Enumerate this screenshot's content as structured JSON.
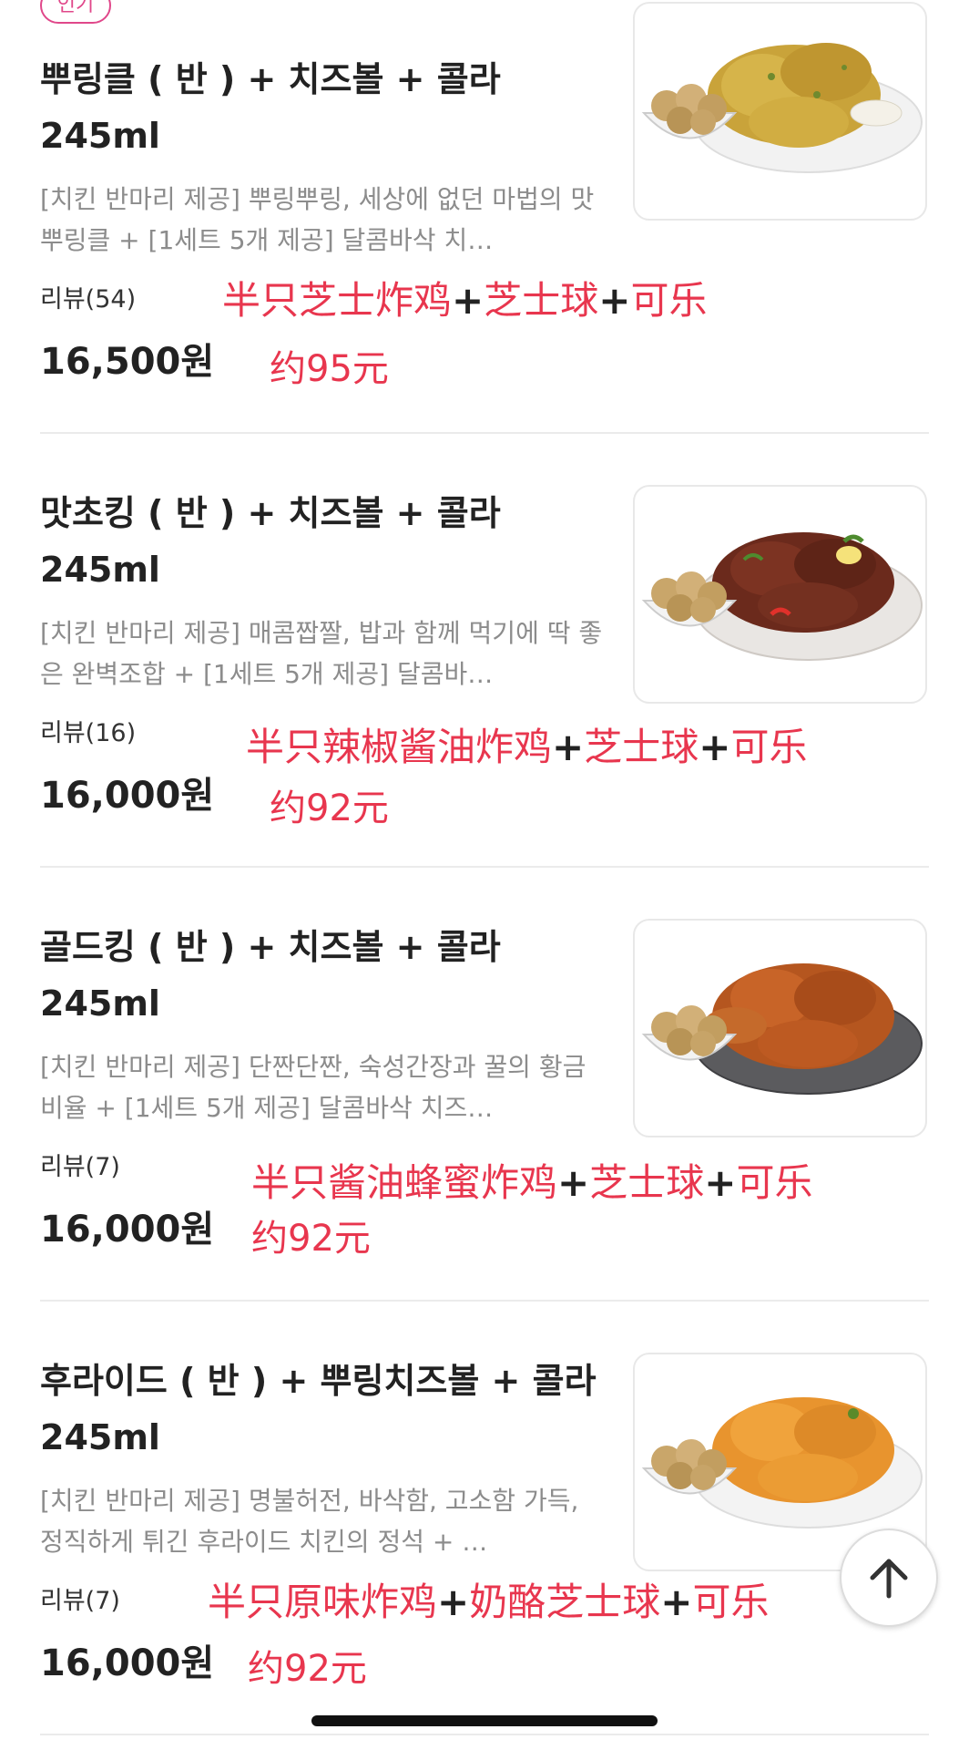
{
  "top_badge": "인기",
  "items": [
    {
      "title": "뿌링클 ( 반 ) + 치즈볼 + 콜라 245ml",
      "desc": "[치킨 반마리 제공] 뿌링뿌링, 세상에 없던 마법의 맛 뿌링클 + [1세트 5개 제공] 달콤바삭 치…",
      "reviews": "리뷰(54)",
      "price": "16,500원",
      "note_parts": [
        "半只芝士炸鸡",
        "芝士球",
        "可乐"
      ],
      "note_price": "约95元",
      "image": "seasoned-powder-chicken-with-cheese-balls"
    },
    {
      "title": "맛초킹 ( 반 ) + 치즈볼 + 콜라 245ml",
      "desc": "[치킨 반마리 제공] 매콤짭짤, 밥과 함께 먹기에 딱 좋은 완벽조합 + [1세트 5개 제공] 달콤바…",
      "reviews": "리뷰(16)",
      "price": "16,000원",
      "note_parts": [
        "半只辣椒酱油炸鸡",
        "芝士球",
        "可乐"
      ],
      "note_price": "约92元",
      "image": "soy-pepper-chicken-with-cheese-balls"
    },
    {
      "title": "골드킹 ( 반 ) + 치즈볼 + 콜라 245ml",
      "desc": "[치킨 반마리 제공] 단짠단짠, 숙성간장과 꿀의 황금비율 + [1세트 5개 제공] 달콤바삭 치즈…",
      "reviews": "리뷰(7)",
      "price": "16,000원",
      "note_parts": [
        "半只酱油蜂蜜炸鸡",
        "芝士球",
        "可乐"
      ],
      "note_price": "约92元",
      "image": "honey-soy-chicken-with-cheese-balls"
    },
    {
      "title": "후라이드 ( 반 ) + 뿌링치즈볼 + 콜라 245ml",
      "desc": "[치킨 반마리 제공] 명불허전, 바삭함, 고소함 가득, 정직하게 튀긴 후라이드 치킨의 정석 + …",
      "reviews": "리뷰(7)",
      "price": "16,000원",
      "note_parts": [
        "半只原味炸鸡",
        "奶酪芝士球",
        "可乐"
      ],
      "note_price": "约92元",
      "image": "fried-chicken-with-cheese-balls"
    }
  ],
  "note_plus": "+",
  "colors": {
    "accent_pink": "#e0478a",
    "note_red": "#e8364e",
    "text": "#222222",
    "desc_gray": "#8c8c8c"
  },
  "icons": {
    "scroll_top": "arrow-up-icon"
  }
}
